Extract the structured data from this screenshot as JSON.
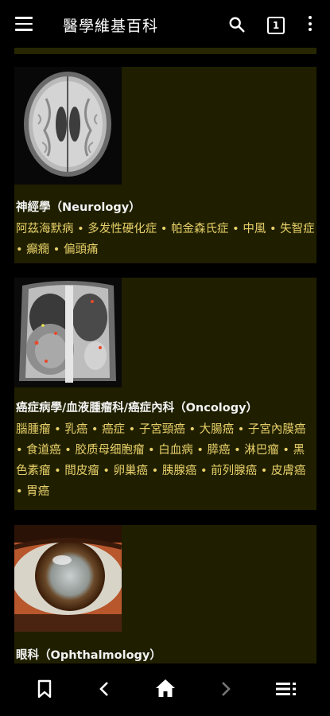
{
  "appbar": {
    "title": "醫學維基百科",
    "tab_count": "1"
  },
  "cards": [
    {
      "category": "神經學（Neurology）",
      "links": [
        "阿茲海默病",
        "多发性硬化症",
        "帕金森氏症",
        "中風",
        "失智症",
        "癲癇",
        "偏頭痛"
      ]
    },
    {
      "category": "癌症病學/血液腫瘤科/癌症內科（Oncology）",
      "links": [
        "腦腫瘤",
        "乳癌",
        "癌症",
        "子宮頸癌",
        "大腸癌",
        "子宮內膜癌",
        "食道癌",
        "胶质母细胞瘤",
        "白血病",
        "膵癌",
        "淋巴瘤",
        "黑色素瘤",
        "間皮瘤",
        "卵巢癌",
        "胰腺癌",
        "前列腺癌",
        "皮膚癌",
        "胃癌"
      ]
    },
    {
      "category": "眼科（Ophthalmology）",
      "links": []
    }
  ],
  "icons": {
    "menu": "menu-icon",
    "search": "search-icon",
    "tabs": "tabs-icon",
    "more": "more-vert-icon",
    "bookmark": "bookmark-icon",
    "back": "chevron-left-icon",
    "home": "home-icon",
    "forward": "chevron-right-icon",
    "toc": "list-icon"
  },
  "colors": {
    "background": "#000000",
    "card": "#1f1f00",
    "link": "#e8d06a"
  }
}
